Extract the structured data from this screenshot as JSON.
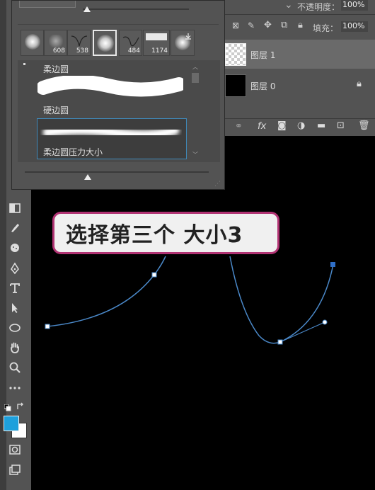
{
  "options_bar": {
    "opacity_label": "不透明度：",
    "opacity_value": "100%",
    "fill_label": "填充：",
    "fill_value": "100%"
  },
  "brush_panel": {
    "thumbnails": [
      {
        "label": ""
      },
      {
        "label": "608"
      },
      {
        "label": "538"
      },
      {
        "label": ""
      },
      {
        "label": "484"
      },
      {
        "label": "1174"
      },
      {
        "label": ""
      }
    ],
    "brushes": [
      {
        "label": "柔边圆"
      },
      {
        "label": "硬边圆"
      },
      {
        "label": "柔边圆压力大小"
      }
    ]
  },
  "layers": [
    {
      "name": "图层 1",
      "locked": false
    },
    {
      "name": "图层 0",
      "locked": true
    }
  ],
  "caption": "选择第三个 大小3",
  "colors": {
    "foreground": "#1ea0dc",
    "background": "#ffffff",
    "caption_border": "#b13373",
    "path": "#4a88c8"
  }
}
